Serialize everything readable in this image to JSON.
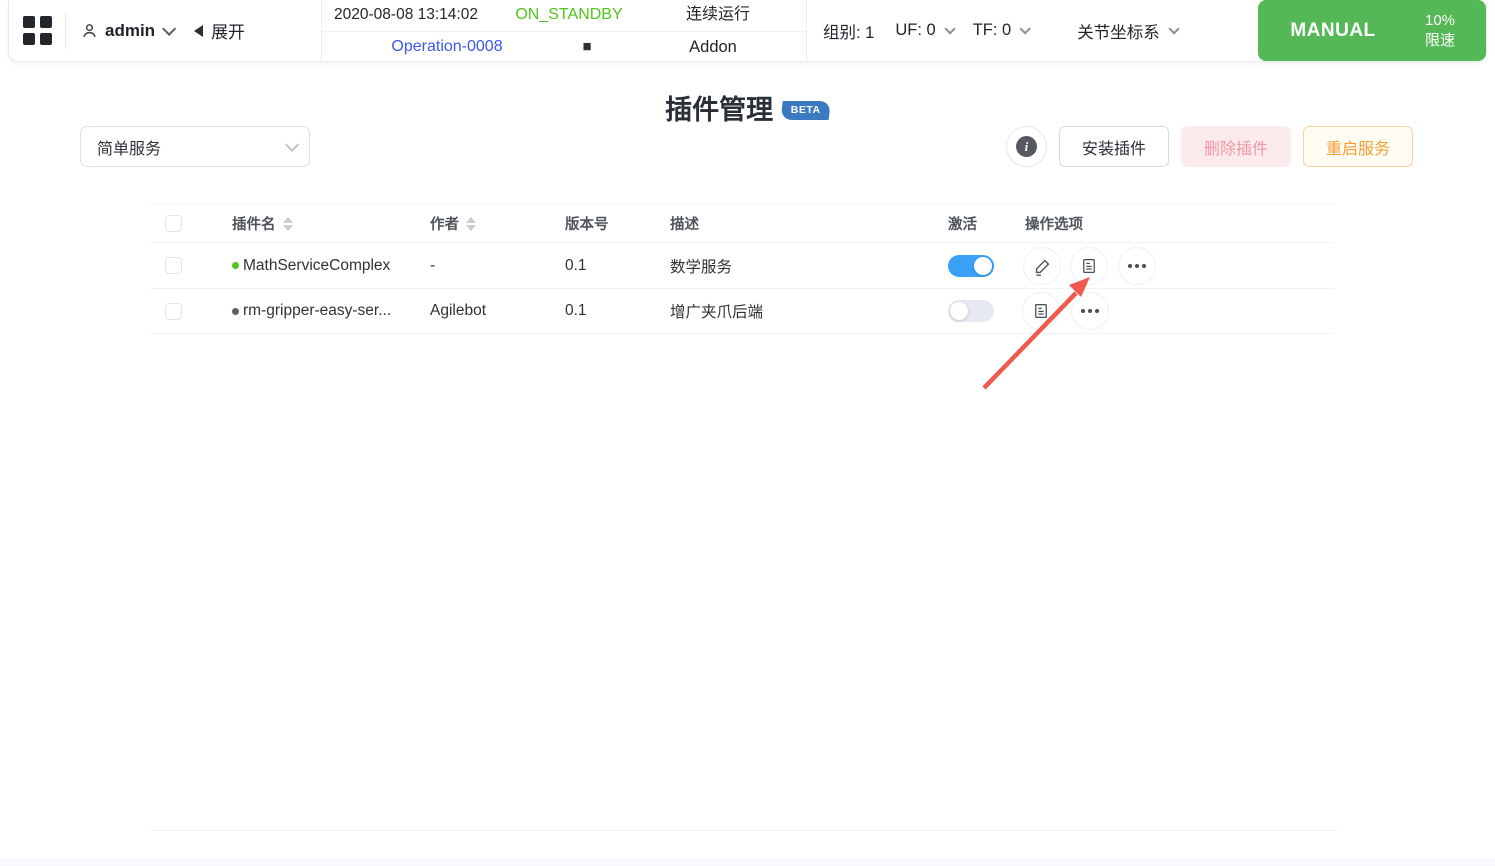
{
  "topbar": {
    "user": {
      "name": "admin",
      "collapse_label": "展开"
    },
    "status": {
      "timestamp": "2020-08-08 13:14:02",
      "robot_state": "ON_STANDBY",
      "run_mode": "连续运行",
      "operation": "Operation-0008",
      "stop_icon": "■",
      "addon_label": "Addon"
    },
    "settings": {
      "group_label": "组别: 1",
      "uf_label": "UF: 0",
      "tf_label": "TF: 0",
      "coord_label": "关节坐标系"
    },
    "mode": {
      "label": "MANUAL",
      "speed_value": "10%",
      "speed_label": "限速"
    }
  },
  "page": {
    "title": "插件管理",
    "beta_badge": "BETA",
    "service_filter_value": "简单服务",
    "info_icon": "i",
    "buttons": {
      "install": "安装插件",
      "delete": "删除插件",
      "restart": "重启服务"
    }
  },
  "table": {
    "headers": {
      "name": "插件名",
      "author": "作者",
      "version": "版本号",
      "description": "描述",
      "active": "激活",
      "actions": "操作选项"
    },
    "rows": [
      {
        "name": "MathServiceComplex",
        "author": "-",
        "version": "0.1",
        "description": "数学服务",
        "active": true,
        "dot_color": "#52c41a",
        "actions": [
          "edit-icon",
          "detail-icon",
          "more-icon"
        ]
      },
      {
        "name": "rm-gripper-easy-ser...",
        "author": "Agilebot",
        "version": "0.1",
        "description": "增广夹爪后端",
        "active": false,
        "dot_color": "#5d6166",
        "actions": [
          "detail-icon",
          "more-icon"
        ]
      }
    ]
  },
  "annotation": {
    "arrow_color": "#f2594e",
    "arrow_target": "detail-icon-row-1"
  },
  "colors": {
    "manual_green": "#54b857",
    "state_green": "#52c41a",
    "link_blue": "#3d57f0",
    "toggle_blue": "#3aa0f8",
    "beta_blue": "#3c7ac0",
    "delete_pink": "#f198a4",
    "restart_orange": "#f59e37"
  }
}
